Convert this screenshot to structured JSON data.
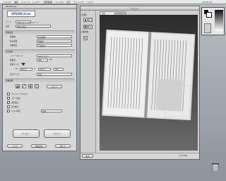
{
  "menubar": {
    "items": [
      "ファイル",
      "編集",
      "イメージ",
      "レイヤー",
      "選択範囲",
      "フィルタ",
      "表示",
      "ウィンドウ",
      "ヘルプ"
    ],
    "clock": "10:05:19"
  },
  "scan": {
    "title": "EPSON Scan",
    "logo": "EPSON Scan",
    "mode_label": "モード",
    "mode_value": "プロフェッショナルモード",
    "settings_label": "設定",
    "settings_value": "現在の設定",
    "original_section": "原稿設定",
    "doc_type_label": "原稿種",
    "doc_type_value": "反射原稿",
    "source_label": "取込装置",
    "source_value": "原稿台",
    "auto_exposure_label": "自動露出",
    "auto_exposure_value": "写真向き",
    "output_section": "出力設定",
    "image_type_label": "イメージタイプ",
    "image_type_value": "24bit カラー",
    "resolution_label": "解像度",
    "resolution_value": "300",
    "resolution_unit": "dpi",
    "doc_size_label": "原稿サイズ",
    "width_label": "W",
    "width_value": "297.0",
    "height_label": "H",
    "height_value": "210.0",
    "size_unit": "mm",
    "target_label": "出力サイズ",
    "target_value": "等倍",
    "adjust_section": "画像調整",
    "reset_label": "リセット",
    "unsharp_label": "アンシャープマスク",
    "descreen_label": "モアレ除去",
    "color_restore_label": "退色復元",
    "backlight_label": "逆光補正",
    "dust_label": "ホコリ除去",
    "dust_value": "標準",
    "preview_button": "プレビュー",
    "scan_button": "スキャン",
    "help_button": "ヘルプ",
    "config_button": "環境設定",
    "close_button": "閉じる"
  },
  "preview": {
    "title": "プレビュー",
    "tab_normal": "通常",
    "tab_thumb": "サムネイル",
    "tool_labels": [
      "全選択",
      "自動領域"
    ],
    "status_left": "拡大",
    "status_right": "14.3 MB"
  },
  "colors": {
    "accent": "#1d4f9a",
    "dialog_bg": "#d6d6d6",
    "desktop": "#9aa0a8"
  }
}
